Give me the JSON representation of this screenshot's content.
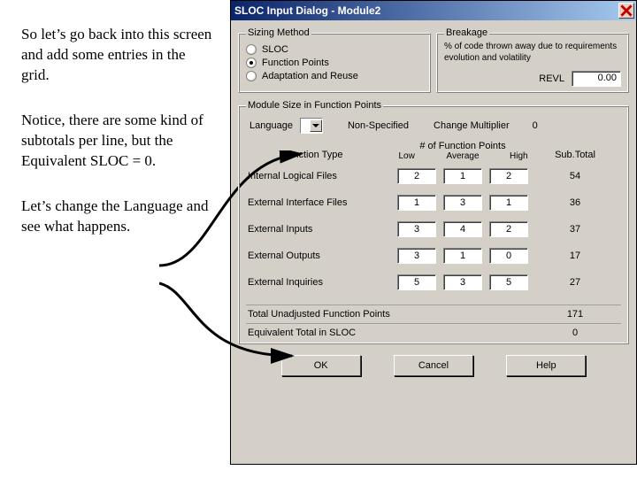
{
  "annotations": {
    "p1": "So let’s go back into this screen and add some entries in the grid.",
    "p2": "Notice, there are some kind of subtotals per line, but the Equivalent SLOC = 0.",
    "p3": "Let’s change the Language and see what happens."
  },
  "window": {
    "title": "SLOC Input Dialog - Module2"
  },
  "sizing_method": {
    "legend": "Sizing Method",
    "options": [
      "SLOC",
      "Function Points",
      "Adaptation and Reuse"
    ],
    "selected": 1
  },
  "breakage": {
    "legend": "Breakage",
    "desc": "% of code thrown away due to requirements evolution and volatility",
    "revl_label": "REVL",
    "revl_value": "0.00"
  },
  "module_size": {
    "legend": "Module Size in Function Points",
    "language_label": "Language",
    "language_value": "Non-Specified",
    "change_mult_label": "Change Multiplier",
    "change_mult_value": "0",
    "head_type": "Function Type",
    "head_nums": "# of Function Points",
    "head_cols": [
      "Low",
      "Average",
      "High"
    ],
    "head_sub": "Sub.Total",
    "rows": [
      {
        "label": "Internal Logical Files",
        "low": "2",
        "avg": "1",
        "high": "2",
        "sub": "54"
      },
      {
        "label": "External Interface Files",
        "low": "1",
        "avg": "3",
        "high": "1",
        "sub": "36"
      },
      {
        "label": "External Inputs",
        "low": "3",
        "avg": "4",
        "high": "2",
        "sub": "37"
      },
      {
        "label": "External Outputs",
        "low": "3",
        "avg": "1",
        "high": "0",
        "sub": "17"
      },
      {
        "label": "External Inquiries",
        "low": "5",
        "avg": "3",
        "high": "5",
        "sub": "27"
      }
    ],
    "total_label": "Total Unadjusted Function Points",
    "total_value": "171",
    "equiv_label": "Equivalent Total in SLOC",
    "equiv_value": "0"
  },
  "buttons": {
    "ok": "OK",
    "cancel": "Cancel",
    "help": "Help"
  }
}
